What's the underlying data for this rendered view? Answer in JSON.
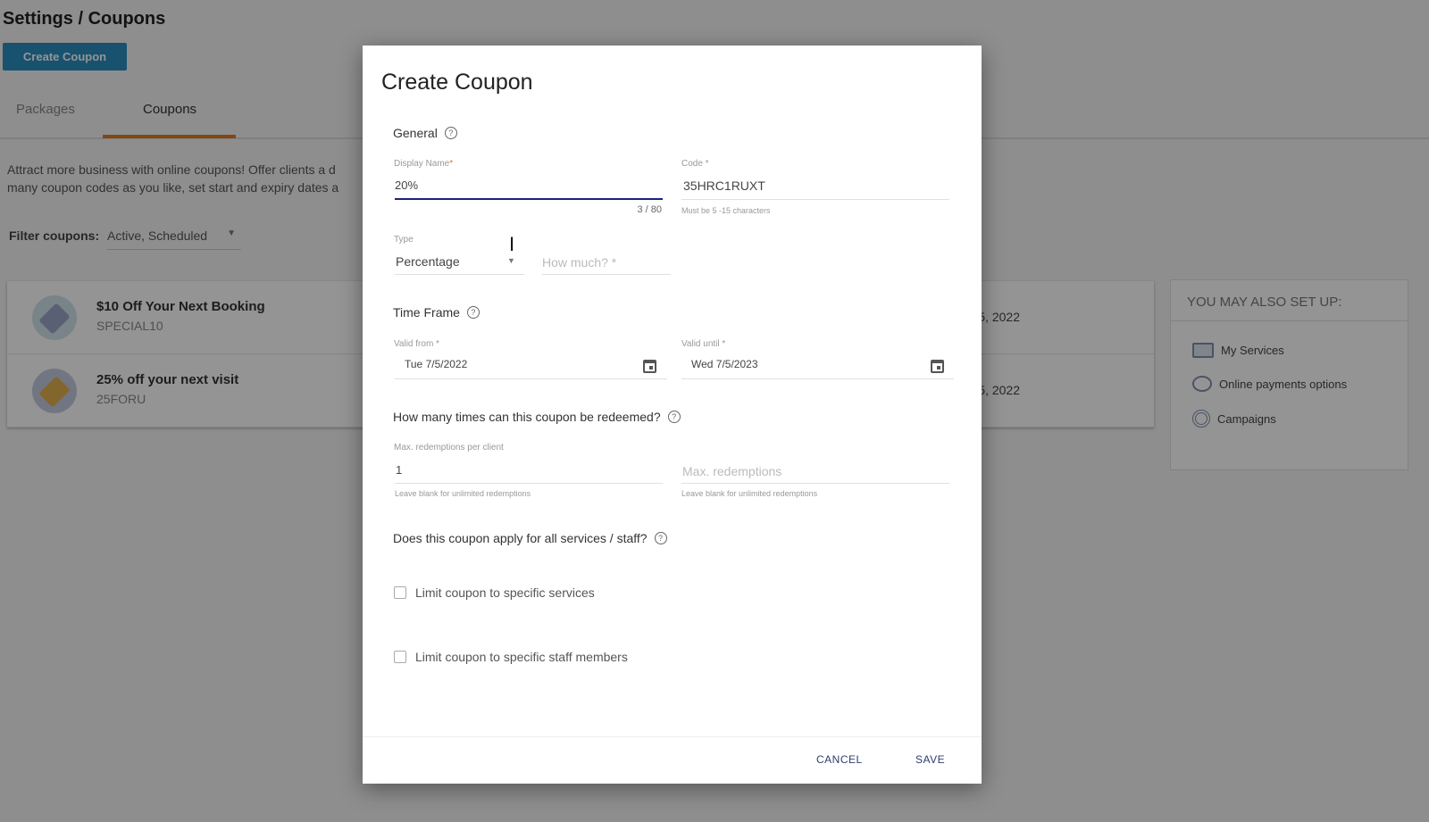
{
  "page": {
    "title": "Settings / Coupons",
    "create_button": "Create Coupon",
    "tabs": [
      {
        "label": "Packages"
      },
      {
        "label": "Coupons"
      }
    ],
    "intro_line1": "Attract more business with online coupons! Offer clients a d",
    "intro_line2": "many coupon codes as you like, set start and expiry dates a",
    "filter_label": "Filter coupons:",
    "filter_value": "Active, Scheduled",
    "coupons": [
      {
        "name": "$10 Off Your Next Booking",
        "code": "SPECIAL10",
        "date": "5, 2022",
        "icon": "price-tag-icon",
        "color": "#9aa6c8"
      },
      {
        "name": "25% off your next visit",
        "code": "25FORU",
        "date": "5, 2022",
        "icon": "price-tag-icon",
        "color": "#e0b050"
      }
    ],
    "sidebar": {
      "title": "YOU MAY ALSO SET UP:",
      "items": [
        {
          "label": "My Services",
          "icon": "briefcase-icon"
        },
        {
          "label": "Online payments options",
          "icon": "coins-icon"
        },
        {
          "label": "Campaigns",
          "icon": "target-icon"
        }
      ]
    },
    "accent": "#2a8dc0",
    "tab_accent": "#e07b20"
  },
  "modal": {
    "title": "Create Coupon",
    "general": "General",
    "display_name_label": "Display Name",
    "required_mark": "*",
    "display_name_value": "20%",
    "counter": "3 / 80",
    "code_label": "Code *",
    "code_value": "35HRC1RUXT",
    "code_hint": "Must be 5 -15 characters",
    "type_label": "Type",
    "type_value": "Percentage",
    "how_much_placeholder": "How much? *",
    "time_frame": "Time Frame",
    "valid_from_label": "Valid from *",
    "valid_from_value": "Tue 7/5/2022",
    "valid_until_label": "Valid until *",
    "valid_until_value": "Wed 7/5/2023",
    "redeem_heading": "How many times can this coupon be redeemed?",
    "max_per_client_label": "Max. redemptions per client",
    "max_per_client_value": "1",
    "max_redemptions_placeholder": "Max. redemptions",
    "blank_hint": "Leave blank for unlimited redemptions",
    "apply_heading": "Does this coupon apply for all services / staff?",
    "limit_services": "Limit coupon to specific services",
    "limit_staff": "Limit coupon to specific staff members",
    "cancel": "CANCEL",
    "save": "SAVE"
  }
}
